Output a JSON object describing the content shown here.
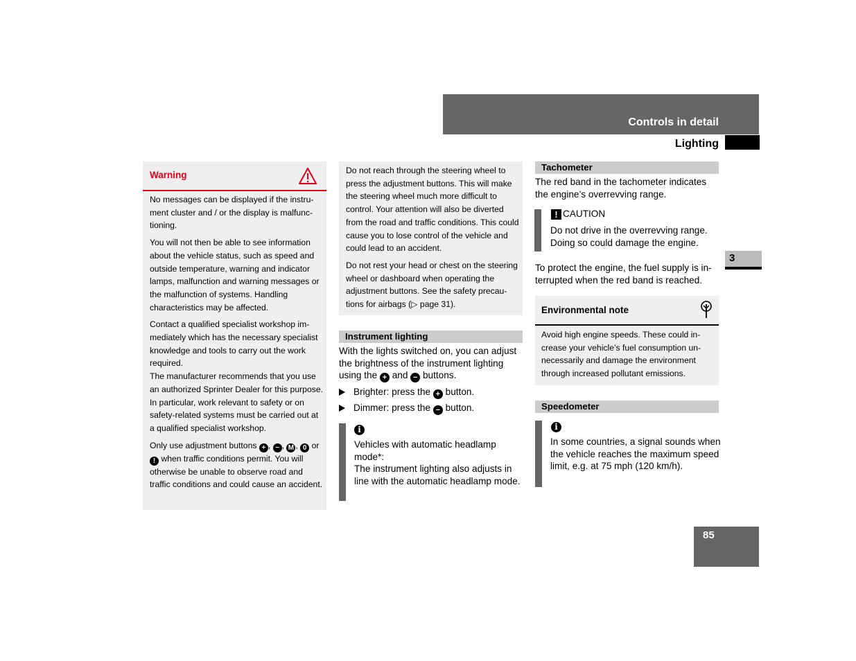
{
  "header": {
    "chapter_title": "Controls in detail",
    "section_title": "Lighting"
  },
  "chapter_tab": "3",
  "page_number": "85",
  "warning": {
    "title": "Warning",
    "icon": "warning-triangle-icon",
    "paragraphs": [
      "No messages can be displayed if the instru­ment cluster and / or the display is malfunc­tioning.",
      "You will not then be able to see information about the vehicle status, such as speed and outside temperature, warning and indicator lamps, malfunction and warning messages or the malfunction of systems. Handling characteristics may be affected.",
      "Contact a qualified specialist workshop im­mediately which has the necessary special­ist knowledge and tools to carry out the work required.",
      "The manufacturer recommends that you use an authorized Sprinter Dealer for this pur­pose. In particular, work relevant to safety or on safety-related systems must be car­ried out at a qualified specialist workshop."
    ],
    "buttons_sentence": {
      "prefix": "Only use adjustment buttons",
      "buttons": [
        "+",
        "−",
        "M",
        "0",
        "!"
      ],
      "or": "or",
      "suffix": "when traffic conditions permit. You will otherwise be unable to observe road and traffic conditions and could cause an ac­cident."
    }
  },
  "warning_continued": {
    "paragraphs": [
      "Do not reach through the steering wheel to press the adjustment buttons. This will make the steering wheel much more difficult to control. Your attention will also be divert­ed from the road and traffic conditions. This could cause you to lose control of the vehi­cle and could lead to an accident.",
      "Do not rest your head or chest on the steer­ing wheel or dashboard when operating the adjustment buttons. See the safety precau­tions for airbags (▷ page 31)."
    ]
  },
  "instrument_lighting": {
    "heading": "Instrument lighting",
    "intro_a": "With the lights switched on, you can adjust the brightness of the instrument lighting using the",
    "intro_and": "and",
    "intro_b": "buttons.",
    "steps": [
      {
        "prefix": "Brighter: press the",
        "button": "+",
        "suffix": "button."
      },
      {
        "prefix": "Dimmer: press the",
        "button": "−",
        "suffix": "button."
      }
    ],
    "info_note": {
      "icon": "info-icon",
      "line1": "Vehicles with automatic headlamp mode*:",
      "line2": "The instrument lighting also adjusts in line with the automatic headlamp mode."
    }
  },
  "tachometer": {
    "heading": "Tachometer",
    "text": "The red band in the tachometer indicates the engine’s overrevving range.",
    "caution": {
      "label": "CAUTION",
      "text": "Do not drive in the overrevving range. Doing so could damage the engine."
    },
    "text2": "To protect the engine, the fuel supply is in­terrupted when the red band is reached."
  },
  "environmental_note": {
    "title": "Environmental note",
    "icon": "tree-icon",
    "text": "Avoid high engine speeds. These could in­crease your vehicle’s fuel consumption un­necessarily and damage the environment through increased pollutant emissions."
  },
  "speedometer": {
    "heading": "Speedometer",
    "info_note": {
      "icon": "info-icon",
      "text": "In some countries, a signal sounds when the vehicle reaches the maximum speed limit, e.g. at 75 mph (120 km/h)."
    }
  },
  "colors": {
    "warning_red": "#e2001a",
    "header_gray": "#666666",
    "box_bg": "#efefef",
    "section_header_bg": "#cccccc"
  }
}
